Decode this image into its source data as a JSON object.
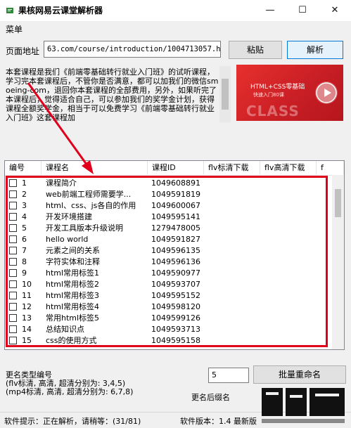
{
  "window": {
    "title": "果核网易云课堂解析器",
    "minimize": "—",
    "maximize": "☐",
    "close": "✕"
  },
  "menu": {
    "item": "菜单"
  },
  "address": {
    "label": "页面地址",
    "value": "63.com/course/introduction/1004713057.htm",
    "paste_button": "粘贴",
    "parse_button": "解析"
  },
  "description": "本套课程是我们《前端零基础转行就业入门班》的试听课程，学习完本套课程后，不管你是否满意，都可以加我们的微信smoeing-com，退回你本套课程的全部费用，另外，如果听完了本课程后，觉得适合自己，可以参加我们的奖学金计划，获得课程全额奖学金，相当于可以免费学习《前端零基础转行就业入门班》这套课程加",
  "banner": {
    "title": "HTML+CSS零基础",
    "subtitle": "快速入门80课",
    "word": "CLASS"
  },
  "table": {
    "columns": [
      "编号",
      "课程名",
      "课程ID",
      "flv标清下载",
      "flv高清下载",
      "f"
    ],
    "rows": [
      {
        "no": "1",
        "name": "课程简介",
        "id": "1049608891"
      },
      {
        "no": "2",
        "name": "web前端工程师需要学...",
        "id": "1049591819"
      },
      {
        "no": "3",
        "name": "html、css、js各自的作用",
        "id": "1049600067"
      },
      {
        "no": "4",
        "name": "开发环境搭建",
        "id": "1049595141"
      },
      {
        "no": "5",
        "name": "开发工具版本升级说明",
        "id": "1279478005"
      },
      {
        "no": "6",
        "name": "hello world",
        "id": "1049591827"
      },
      {
        "no": "7",
        "name": "元素之间的关系",
        "id": "1049596135"
      },
      {
        "no": "8",
        "name": "字符实体和注释",
        "id": "1049596136"
      },
      {
        "no": "9",
        "name": "html常用标签1",
        "id": "1049590977"
      },
      {
        "no": "10",
        "name": "html常用标签2",
        "id": "1049593707"
      },
      {
        "no": "11",
        "name": "html常用标签3",
        "id": "1049595152"
      },
      {
        "no": "12",
        "name": "html常用标签4",
        "id": "1049598120"
      },
      {
        "no": "13",
        "name": "常用html标签5",
        "id": "1049599126"
      },
      {
        "no": "14",
        "name": "总结知识点",
        "id": "1049593713"
      },
      {
        "no": "15",
        "name": "css的使用方式",
        "id": "1049595158"
      }
    ]
  },
  "bottom": {
    "note": "更名类型编号\n(flv标清, 高清, 超清分别为: 3,4,5)\n(mp4标清, 高清, 超清分别为: 6,7,8)",
    "number_value": "5",
    "rename_button": "批量重命名",
    "suffix_label": "更名后缀名"
  },
  "status": {
    "left": "软件提示：正在解析，请稍等：(31/81)",
    "right": "软件版本：1.4 最新版"
  },
  "colors": {
    "highlight": "#e0001b",
    "banner": "#e8302e",
    "app_icon": "#2e8b3a"
  }
}
